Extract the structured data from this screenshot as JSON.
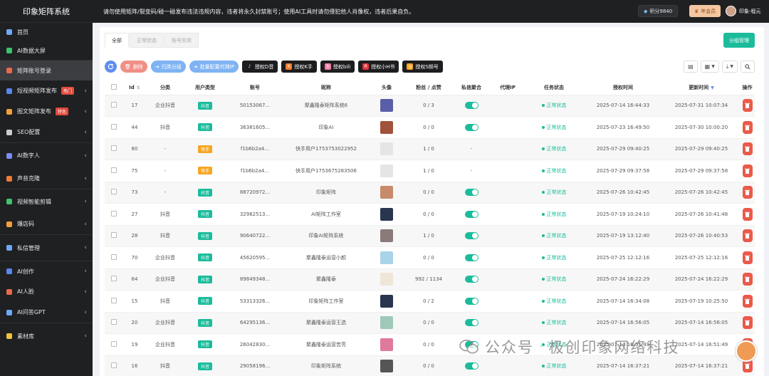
{
  "app": {
    "title": "印象矩阵系统"
  },
  "header": {
    "notice": "请勿使用矩阵/裂变码/碰一碰发布违法违规内容，违者将永久封禁账号；使用AI工具时请勿侵犯他人肖像权，违者后果自负。",
    "points": "积分9840",
    "vip": "年会员",
    "user": "印象-程元"
  },
  "sidebar": {
    "items": [
      {
        "label": "首页",
        "icon": "pie-chart-icon",
        "color": "#6fa8f5"
      },
      {
        "label": "AI数据大屏",
        "icon": "screen-icon",
        "color": "#3ec46d"
      },
      {
        "label": "矩阵账号登录",
        "icon": "shuffle-icon",
        "color": "#e86a4a"
      },
      {
        "label": "短视频矩阵发布",
        "icon": "video-icon",
        "color": "#5b86f0",
        "badge": "热门"
      },
      {
        "label": "图文矩阵发布",
        "icon": "image-icon",
        "color": "#f0a13a",
        "badge": "特色"
      },
      {
        "label": "SEO配置",
        "icon": "gear-icon",
        "color": "#cccccc"
      },
      {
        "label": "AI数字人",
        "icon": "digital-human-icon",
        "color": "#7b8cf5"
      },
      {
        "label": "声音克隆",
        "icon": "voice-icon",
        "color": "#f07a3a"
      },
      {
        "label": "视频智能剪辑",
        "icon": "clip-icon",
        "color": "#3ec46d"
      },
      {
        "label": "爆店码",
        "icon": "qrcode-icon",
        "color": "#f0a13a"
      },
      {
        "label": "私信管理",
        "icon": "message-icon",
        "color": "#6fa8f5"
      },
      {
        "label": "AI创作",
        "icon": "pen-icon",
        "color": "#5b86f0"
      },
      {
        "label": "AI人脸",
        "icon": "face-icon",
        "color": "#e86a4a"
      },
      {
        "label": "AI问答GPT",
        "icon": "chat-icon",
        "color": "#6fa8f5"
      },
      {
        "label": "素材库",
        "icon": "folder-icon",
        "color": "#f0c23a"
      }
    ]
  },
  "tabs": [
    "全部",
    "正常状态",
    "账号失效"
  ],
  "group_button": "分组管理",
  "toolbar": {
    "delete": "删除",
    "group": "归类分组",
    "proxy": "批量配置代理IP",
    "douyin": "授权D音",
    "kuaishou": "授权K手",
    "bili": "授权bili",
    "xhs": "授权小H书",
    "shipin": "授权S频号"
  },
  "table": {
    "headers": [
      "Id",
      "分类",
      "用户类型",
      "账号",
      "昵称",
      "头像",
      "粉丝 / 点赞",
      "私信聚合",
      "代理IP",
      "任务状态",
      "授权时间",
      "更新时间",
      "操作"
    ],
    "rows": [
      {
        "id": "17",
        "category": "企业抖音",
        "type": "抖音",
        "account": "50153067...",
        "nick": "聚鑫隆泰矩阵系统6",
        "stats": "0 / 3",
        "dm": "toggle",
        "proxy": "",
        "status": "正常状态",
        "auth": "2025-07-14 16:44:33",
        "update": "2025-07-31 10:07:34",
        "thumb": "#5a5ea8"
      },
      {
        "id": "44",
        "category": "抖音",
        "type": "抖音",
        "account": "36381605...",
        "nick": "印象AI",
        "stats": "0 / 0",
        "dm": "toggle",
        "proxy": "",
        "status": "正常状态",
        "auth": "2025-07-23 16:49:50",
        "update": "2025-07-30 10:00:20",
        "thumb": "#a0523a"
      },
      {
        "id": "80",
        "category": "-",
        "type": "快手",
        "account": "f1b6b2a4...",
        "nick": "快手用户1753753022952",
        "stats": "1 / 0",
        "dm": "-",
        "proxy": "",
        "status": "正常状态",
        "auth": "2025-07-29 09:40:25",
        "update": "2025-07-29 09:40:25",
        "thumb": "#e5e5e5"
      },
      {
        "id": "75",
        "category": "-",
        "type": "快手",
        "account": "f1b6b2a4...",
        "nick": "快手用户1753675283506",
        "stats": "1 / 0",
        "dm": "-",
        "proxy": "",
        "status": "正常状态",
        "auth": "2025-07-29 09:37:58",
        "update": "2025-07-29 09:37:58",
        "thumb": "#e5e5e5"
      },
      {
        "id": "73",
        "category": "-",
        "type": "抖音",
        "account": "88720972...",
        "nick": "印象矩阵",
        "stats": "0 / 0",
        "dm": "toggle",
        "proxy": "",
        "status": "正常状态",
        "auth": "2025-07-26 10:42:45",
        "update": "2025-07-26 10:42:45",
        "thumb": "#c78a6a"
      },
      {
        "id": "27",
        "category": "抖音",
        "type": "抖音",
        "account": "32982513...",
        "nick": "AI矩阵工作室",
        "stats": "0 / 0",
        "dm": "toggle",
        "proxy": "",
        "status": "正常状态",
        "auth": "2025-07-19 10:24:10",
        "update": "2025-07-26 10:41:48",
        "thumb": "#2a3550"
      },
      {
        "id": "28",
        "category": "抖音",
        "type": "抖音",
        "account": "90640722...",
        "nick": "印象AI矩阵系统",
        "stats": "1 / 0",
        "dm": "toggle",
        "proxy": "",
        "status": "正常状态",
        "auth": "2025-07-19 13:12:40",
        "update": "2025-07-26 10:40:53",
        "thumb": "#8a7a7a"
      },
      {
        "id": "70",
        "category": "企业抖音",
        "type": "抖音",
        "account": "45620595...",
        "nick": "聚鑫隆泰运营小颜",
        "stats": "0 / 0",
        "dm": "toggle",
        "proxy": "",
        "status": "正常状态",
        "auth": "2025-07-25 12:12:16",
        "update": "2025-07-25 12:12:16",
        "thumb": "#a9d3e8"
      },
      {
        "id": "64",
        "category": "企业抖音",
        "type": "抖音",
        "account": "89849348...",
        "nick": "聚鑫隆泰",
        "stats": "992 / 1134",
        "dm": "toggle",
        "proxy": "",
        "status": "正常状态",
        "auth": "2025-07-24 16:22:29",
        "update": "2025-07-24 16:22:29",
        "thumb": "#efe6d8"
      },
      {
        "id": "15",
        "category": "抖音",
        "type": "抖音",
        "account": "53313326...",
        "nick": "印象矩阵工作室",
        "stats": "0 / 2",
        "dm": "toggle",
        "proxy": "",
        "status": "正常状态",
        "auth": "2025-07-14 16:34:08",
        "update": "2025-07-19 10:25:50",
        "thumb": "#2a3550"
      },
      {
        "id": "20",
        "category": "企业抖音",
        "type": "抖音",
        "account": "64295136...",
        "nick": "聚鑫隆泰运营王选",
        "stats": "0 / 0",
        "dm": "toggle",
        "proxy": "",
        "status": "正常状态",
        "auth": "2025-07-14 16:56:05",
        "update": "2025-07-14 16:56:05",
        "thumb": "#9fc8b8"
      },
      {
        "id": "19",
        "category": "企业抖音",
        "type": "抖音",
        "account": "26042830...",
        "nick": "聚鑫隆泰运营苦亮",
        "stats": "0 / 0",
        "dm": "toggle",
        "proxy": "",
        "status": "正常状态",
        "auth": "2025-07-14 16:51:49",
        "update": "2025-07-14 16:51:49",
        "thumb": "#e07a9a"
      },
      {
        "id": "16",
        "category": "抖音",
        "type": "抖音",
        "account": "29058196...",
        "nick": "印象矩阵系统",
        "stats": "0 / 0",
        "dm": "toggle",
        "proxy": "",
        "status": "正常状态",
        "auth": "2025-07-14 16:37:21",
        "update": "2025-07-14 16:37:21",
        "thumb": "#555555"
      }
    ]
  },
  "colors": {
    "accent": "#1bbc9b",
    "douyin_tag": "#1bbc9b",
    "kuaishou_tag": "#f5a623",
    "danger": "#ea5a4a"
  },
  "watermark": {
    "text": "公众号",
    "brand": "极创印象网络科技"
  }
}
